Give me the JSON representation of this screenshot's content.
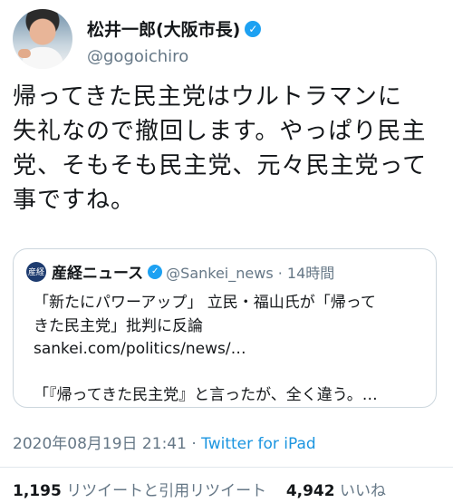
{
  "author": {
    "display_name": "松井一郎(大阪市長)",
    "handle": "@gogoichiro",
    "verified_icon": "✓"
  },
  "tweet": {
    "lines": [
      "帰ってきた民主党はウルトラマンに",
      "失礼なので撤回します。やっぱり民主",
      "党、そもそも民主党、元々民主党って",
      "事ですね。"
    ]
  },
  "quoted": {
    "source_logo": "産経",
    "source_name": "産経ニュース",
    "source_verified_icon": "✓",
    "meta": "@Sankei_news · 14時間",
    "title_line1": "「新たにパワーアップ」 立民・福山氏が「帰って",
    "title_line2": "きた民主党」批判に反論",
    "url": "sankei.com/politics/news/…",
    "excerpt": "「『帰ってきた民主党』と言ったが、全く違う。…"
  },
  "footer": {
    "timestamp": "2020年08月19日 21:41 · ",
    "client": "Twitter for iPad",
    "retweets_count": "1,195",
    "retweets_label": "リツイートと引用リツイート",
    "likes_count": "4,942",
    "likes_label": "いいね"
  }
}
